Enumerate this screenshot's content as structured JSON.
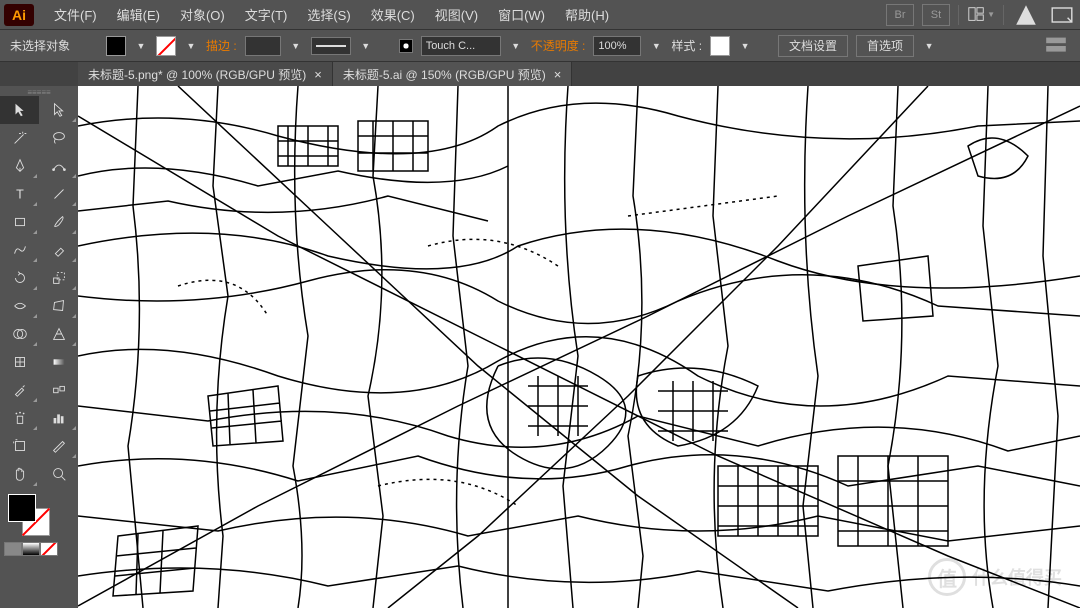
{
  "app": {
    "logo": "Ai"
  },
  "menu": {
    "items": [
      {
        "label": "文件(F)"
      },
      {
        "label": "编辑(E)"
      },
      {
        "label": "对象(O)"
      },
      {
        "label": "文字(T)"
      },
      {
        "label": "选择(S)"
      },
      {
        "label": "效果(C)"
      },
      {
        "label": "视图(V)"
      },
      {
        "label": "窗口(W)"
      },
      {
        "label": "帮助(H)"
      }
    ],
    "bridge": "Br",
    "stock": "St"
  },
  "options": {
    "selection_label": "未选择对象",
    "stroke_label": "描边 :",
    "stroke_weight": "",
    "brush_name": "Touch C...",
    "opacity_label": "不透明度 :",
    "opacity_value": "100%",
    "style_label": "样式 :",
    "doc_setup": "文档设置",
    "prefs": "首选项"
  },
  "tabs": [
    {
      "title": "未标题-5.png* @ 100% (RGB/GPU 预览)",
      "active": false
    },
    {
      "title": "未标题-5.ai @ 150% (RGB/GPU 预览)",
      "active": true
    }
  ],
  "tools_left": [
    "selection",
    "direct-selection",
    "magic-wand",
    "lasso",
    "pen",
    "curvature",
    "type",
    "line",
    "rectangle",
    "paintbrush",
    "shaper",
    "eraser",
    "rotate",
    "scale",
    "width",
    "free-transform",
    "shape-builder",
    "perspective",
    "mesh",
    "gradient",
    "eyedropper",
    "blend",
    "symbol-sprayer",
    "column-graph",
    "artboard",
    "slice",
    "hand",
    "zoom"
  ],
  "watermark": {
    "icon": "值",
    "text": "什么值得买"
  }
}
